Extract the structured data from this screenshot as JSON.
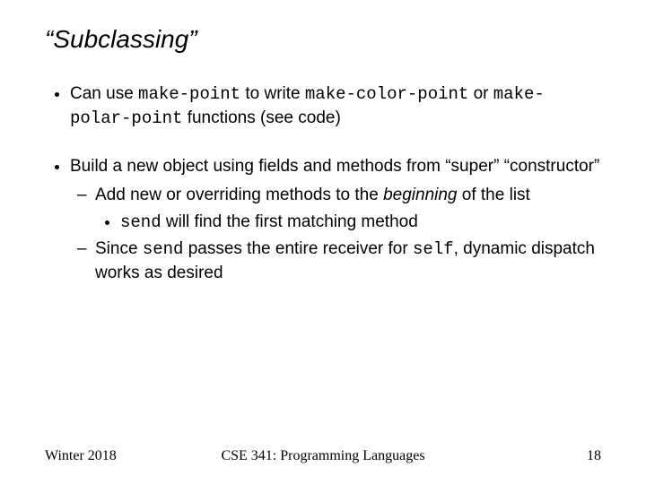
{
  "title": "“Subclassing”",
  "b1_a": "Can use ",
  "b1_code1": "make-point",
  "b1_b": " to write ",
  "b1_code2": "make-color-point",
  "b1_c": " or ",
  "b1_code3": "make-polar-point",
  "b1_d": " functions (see code)",
  "b2": "Build a new object using fields and methods from “super” “constructor”",
  "b2s1_a": "Add new or overriding methods to the ",
  "b2s1_i": "beginning",
  "b2s1_b": " of the list",
  "b2s1s1_code": "send",
  "b2s1s1_a": " will find the first matching method",
  "b2s2_a": "Since ",
  "b2s2_code1": "send",
  "b2s2_b": " passes the entire receiver for ",
  "b2s2_code2": "self",
  "b2s2_c": ", dynamic dispatch works as desired",
  "footer_left": "Winter 2018",
  "footer_center": "CSE 341: Programming Languages",
  "footer_right": "18"
}
